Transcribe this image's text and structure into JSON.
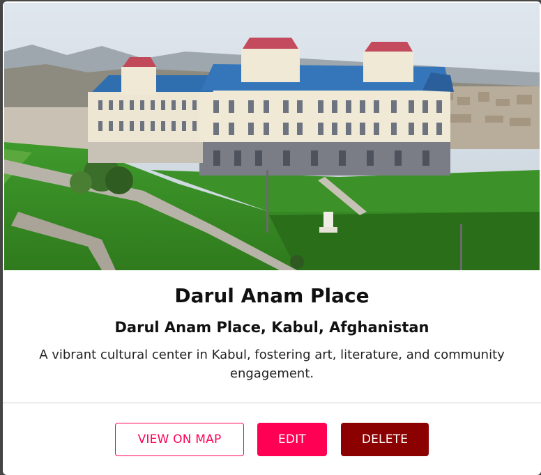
{
  "place": {
    "title": "Darul Anam Place",
    "address": "Darul Anam Place, Kabul, Afghanistan",
    "description": "A vibrant cultural center in Kabul, fostering art, literature, and community engagement."
  },
  "actions": {
    "view_on_map_label": "VIEW ON MAP",
    "edit_label": "EDIT",
    "delete_label": "DELETE"
  },
  "colors": {
    "accent": "#ff0055",
    "danger": "#8b0000",
    "background": "#4a4a4a"
  }
}
